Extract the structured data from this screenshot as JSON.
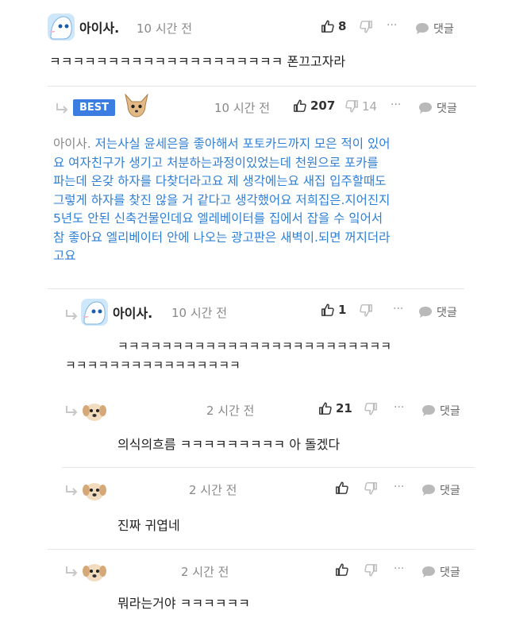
{
  "comments": [
    {
      "nickname": "아이사.",
      "time": "10 시간 전",
      "likes": "8",
      "reply_label": "댓글",
      "more": "···",
      "text": "ㅋㅋㅋㅋㅋㅋㅋㅋㅋㅋㅋㅋㅋㅋㅋㅋㅋㅋㅋㅋ 폰끄고자라"
    },
    {
      "badge": "BEST",
      "time": "10 시간 전",
      "likes": "207",
      "dislikes": "14",
      "reply_label": "댓글",
      "more": "···",
      "mention": "아이사.",
      "lines": [
        "저는사실 윤세은을 좋아해서 포토카드까지 모은 적이 있어",
        "요 여자친구가 생기고 처분하는과정이있었는데 천원으로 포카를",
        "파는데 온갖 하자를 다찾더라고요 제 생각에는요 새집 입주할때도",
        "그렇게 하자를 찾진 않을 거 같다고 생각했어요 저희집은.지어진지",
        "5년도 안된 신축건물인데요 엘레베이터를 집에서 잡을 수 잌어서",
        "참 좋아요 엘리베이터 안에 나오는 광고판은 새벽이.되면 꺼지더라",
        "고요"
      ]
    },
    {
      "nickname": "아이사.",
      "time": "10 시간 전",
      "likes": "1",
      "reply_label": "댓글",
      "more": "···",
      "lines": [
        "ㅋㅋㅋㅋㅋㅋㅋㅋㅋㅋㅋㅋㅋㅋㅋㅋㅋㅋㅋㅋㅋㅋㅋㅋㅋ",
        "ㅋㅋㅋㅋㅋㅋㅋㅋㅋㅋㅋㅋㅋㅋㅋㅋ"
      ]
    },
    {
      "time": "2 시간 전",
      "likes": "21",
      "reply_label": "댓글",
      "more": "···",
      "text": "의식의흐름 ㅋㅋㅋㅋㅋㅋㅋㅋㅋ 아 돌겠다"
    },
    {
      "time": "2 시간 전",
      "reply_label": "댓글",
      "more": "···",
      "text": "진짜 귀엽네"
    },
    {
      "time": "2 시간 전",
      "reply_label": "댓글",
      "more": "···",
      "text": "뭐라는거야 ㅋㅋㅋㅋㅋㅋ"
    }
  ],
  "colors": {
    "best_badge": "#3b7de0",
    "best_text": "#2d7fd6",
    "muted": "#888888"
  },
  "icons": [
    "avatar-cartoon-icon",
    "avatar-cat-icon",
    "avatar-dog-icon",
    "reply-arrow-icon",
    "thumbs-up-icon",
    "thumbs-down-icon",
    "more-icon",
    "speech-bubble-icon"
  ]
}
